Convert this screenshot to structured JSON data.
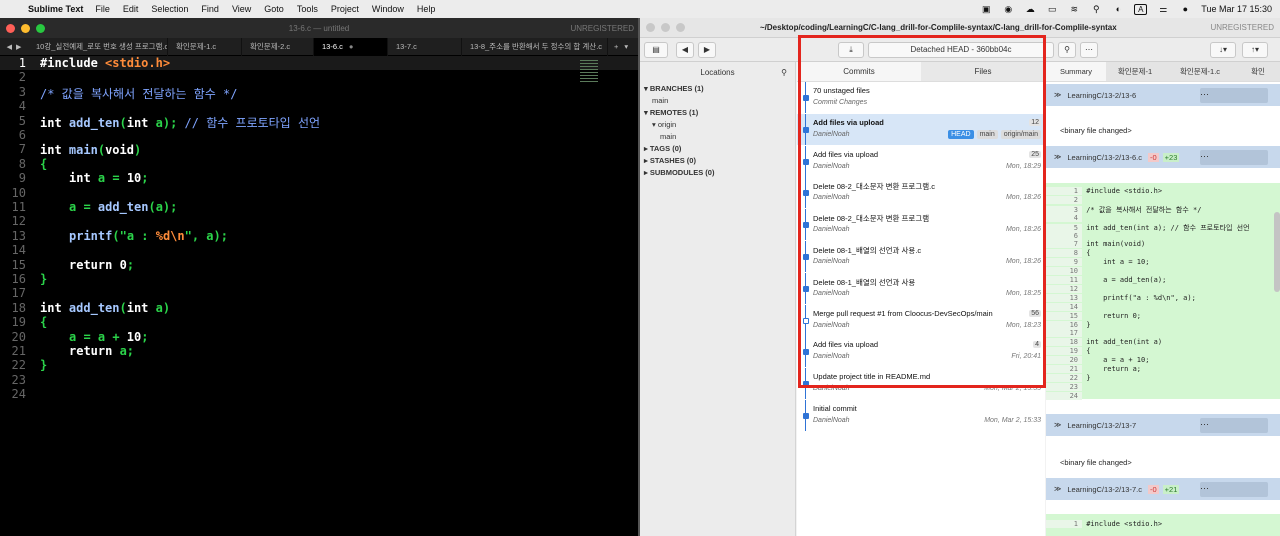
{
  "menubar": {
    "app_name": "Sublime Text",
    "items": [
      "File",
      "Edit",
      "Selection",
      "Find",
      "View",
      "Goto",
      "Tools",
      "Project",
      "Window",
      "Help"
    ],
    "clock": "Tue Mar 17  15:30",
    "input_source": "A"
  },
  "sublime": {
    "window_title": "13-6.c — untitled",
    "unregistered": "UNREGISTERED",
    "tabs": [
      {
        "label": "10강_실전예제_로또 번호 생성 프로그램.c",
        "active": false
      },
      {
        "label": "확인문제-1.c",
        "active": false
      },
      {
        "label": "확인문제-2.c",
        "active": false
      },
      {
        "label": "13-6.c",
        "active": true
      },
      {
        "label": "13-7.c",
        "active": false
      },
      {
        "label": "13-8_주소를 반환해서 두 정수의 합 계산.c",
        "active": false
      }
    ],
    "line_numbers": [
      "1",
      "2",
      "3",
      "4",
      "5",
      "6",
      "7",
      "8",
      "9",
      "10",
      "11",
      "12",
      "13",
      "14",
      "15",
      "16",
      "17",
      "18",
      "19",
      "20",
      "21",
      "22",
      "23",
      "24"
    ],
    "current_line": "1"
  },
  "merge": {
    "path_title": "~/Desktop/coding/LearningC/C-lang_drill-for-Complile-syntax/C-lang_drill-for-Complile-syntax",
    "unregistered": "UNREGISTERED",
    "head_label": "Detached HEAD - 360bb04c",
    "locations_header": "Locations",
    "locations": {
      "branches": "BRANCHES (1)",
      "branch_main": "main",
      "remotes": "REMOTES (1)",
      "remote_origin": "origin",
      "remote_main": "main",
      "tags": "TAGS (0)",
      "stashes": "STASHES (0)",
      "submodules": "SUBMODULES (0)"
    },
    "commit_tabs": [
      "Commits",
      "Files"
    ],
    "commits": [
      {
        "msg": "70 unstaged files",
        "auth": "Commit Changes",
        "time": "",
        "count": "",
        "sel": false,
        "hollow": false
      },
      {
        "msg": "Add files via upload",
        "auth": "DanielNoah",
        "time": "",
        "count": "12",
        "sel": true,
        "hollow": false
      },
      {
        "msg": "Add files via upload",
        "auth": "DanielNoah",
        "time": "Mon, 18:29",
        "count": "25",
        "sel": false,
        "hollow": false
      },
      {
        "msg": "Delete 08-2_대소문자 변환 프로그램.c",
        "auth": "DanielNoah",
        "time": "Mon, 18:26",
        "count": "",
        "sel": false,
        "hollow": false
      },
      {
        "msg": "Delete 08-2_대소문자 변환 프로그램",
        "auth": "DanielNoah",
        "time": "Mon, 18:26",
        "count": "",
        "sel": false,
        "hollow": false
      },
      {
        "msg": "Delete 08-1_배열의 선언과 사용.c",
        "auth": "DanielNoah",
        "time": "Mon, 18:26",
        "count": "",
        "sel": false,
        "hollow": false
      },
      {
        "msg": "Delete 08-1_배열의 선언과 사용",
        "auth": "DanielNoah",
        "time": "Mon, 18:25",
        "count": "",
        "sel": false,
        "hollow": false
      },
      {
        "msg": "Merge pull request #1 from Cloocus-DevSecOps/main",
        "auth": "DanielNoah",
        "time": "Mon, 18:23",
        "count": "56",
        "sel": false,
        "hollow": true
      },
      {
        "msg": "Add files via upload",
        "auth": "DanielNoah",
        "time": "Fri, 20:41",
        "count": "4",
        "sel": false,
        "hollow": false
      },
      {
        "msg": "Update project title in README.md",
        "auth": "DanielNoah",
        "time": "Mon, Mar 2, 15:35",
        "count": "",
        "sel": false,
        "hollow": false
      },
      {
        "msg": "Initial commit",
        "auth": "DanielNoah",
        "time": "Mon, Mar 2, 15:33",
        "count": "",
        "sel": false,
        "hollow": false
      }
    ],
    "head_tags": [
      "HEAD",
      "main",
      "origin/main"
    ],
    "summary_tabs": [
      "Summary",
      "확인문제-1",
      "확인문제-1.c",
      "확인"
    ],
    "file1": {
      "name": "LearningC/13-2/13-6",
      "note": "<binary file changed>"
    },
    "file2": {
      "name": "LearningC/13-2/13-6.c",
      "del": "-0",
      "add": "+23"
    },
    "file3": {
      "name": "LearningC/13-2/13-7",
      "note": "<binary file changed>"
    },
    "file4": {
      "name": "LearningC/13-2/13-7.c",
      "del": "-0",
      "add": "+21"
    },
    "diff_lines": [
      {
        "n": "1",
        "t": "#include <stdio.h>"
      },
      {
        "n": "2",
        "t": ""
      },
      {
        "n": "3",
        "t": "/* 값을 복사해서 전달하는 함수 */"
      },
      {
        "n": "4",
        "t": ""
      },
      {
        "n": "5",
        "t": "int add_ten(int a); // 함수 프로토타입 선언"
      },
      {
        "n": "6",
        "t": ""
      },
      {
        "n": "7",
        "t": "int main(void)"
      },
      {
        "n": "8",
        "t": "{"
      },
      {
        "n": "9",
        "t": "    int a = 10;"
      },
      {
        "n": "10",
        "t": ""
      },
      {
        "n": "11",
        "t": "    a = add_ten(a);"
      },
      {
        "n": "12",
        "t": ""
      },
      {
        "n": "13",
        "t": "    printf(\"a : %d\\n\", a);"
      },
      {
        "n": "14",
        "t": ""
      },
      {
        "n": "15",
        "t": "    return 0;"
      },
      {
        "n": "16",
        "t": "}"
      },
      {
        "n": "17",
        "t": ""
      },
      {
        "n": "18",
        "t": "int add_ten(int a)"
      },
      {
        "n": "19",
        "t": "{"
      },
      {
        "n": "20",
        "t": "    a = a + 10;"
      },
      {
        "n": "21",
        "t": "    return a;"
      },
      {
        "n": "22",
        "t": "}"
      },
      {
        "n": "23",
        "t": ""
      },
      {
        "n": "24",
        "t": ""
      }
    ],
    "diff2_first": {
      "n": "1",
      "t": "#include <stdio.h>"
    }
  },
  "code": {
    "l1_kw": "#include",
    "l1_inc": "<stdio.h>",
    "l3": "/* 값을 복사해서 전달하는 함수 */",
    "l5_ty": "int",
    "l5_fn": "add_ten",
    "l5_a": "(",
    "l5_ty2": "int",
    "l5_b": " a); ",
    "l5_cm": "// 함수 프로토타입 선언",
    "l7_ty": "int",
    "l7_fn": "main",
    "l7_a": "(",
    "l7_ty2": "void",
    "l7_b": ")",
    "l8": "{",
    "l9_ty": "int",
    "l9_b": " a = ",
    "l9_num": "10",
    "l9_c": ";",
    "l11_a": "a = ",
    "l11_fn": "add_ten",
    "l11_b": "(a);",
    "l13_fn": "printf",
    "l13_a": "(",
    "l13_s1": "\"a : ",
    "l13_ps": "%d\\n",
    "l13_s2": "\"",
    "l13_b": ", a);",
    "l15_kw": "return",
    "l15_num": "0",
    "l15_c": ";",
    "l16": "}",
    "l18_ty": "int",
    "l18_fn": "add_ten",
    "l18_a": "(",
    "l18_ty2": "int",
    "l18_b": " a)",
    "l19": "{",
    "l20_a": "a = a + ",
    "l20_num": "10",
    "l20_c": ";",
    "l21_kw": "return",
    "l21_b": " a;",
    "l22": "}"
  },
  "colors": {
    "traffic_close": "#ff5f57",
    "traffic_min": "#febc2e",
    "traffic_max": "#28c840",
    "highlight_box": "#e3251d",
    "commit_graph": "#2f73d6"
  }
}
